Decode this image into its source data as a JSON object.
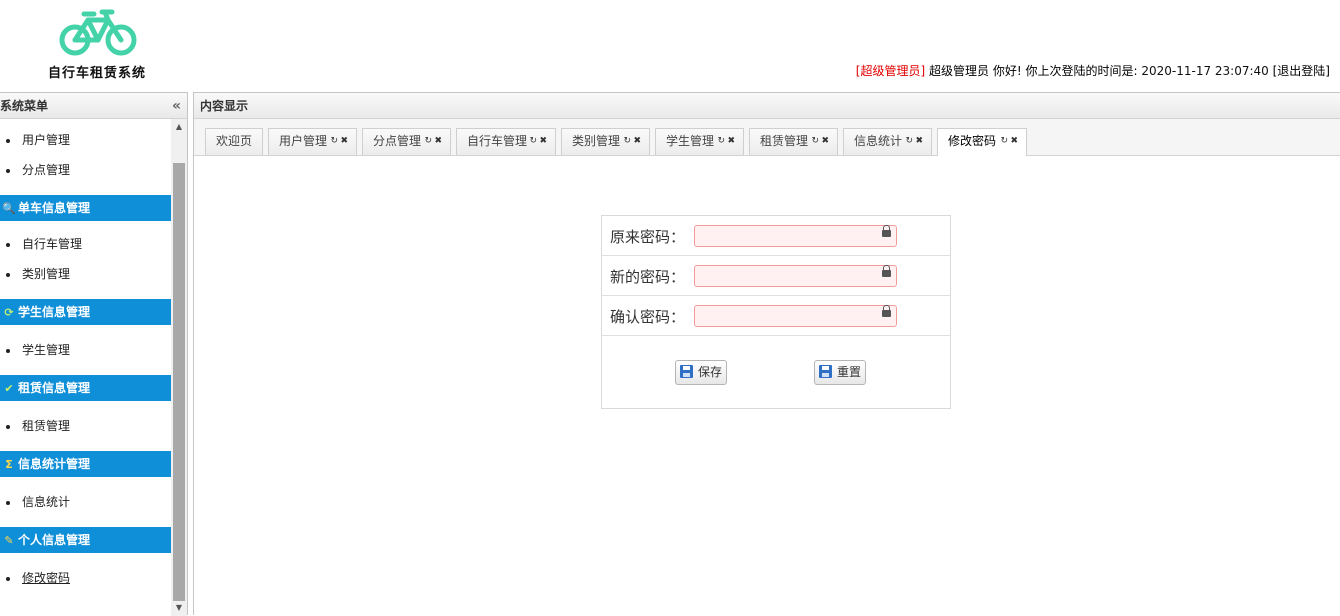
{
  "header": {
    "logo_text": "自行车租赁系统",
    "brand_color": "#44d3a8",
    "user_role": "[超级管理员]",
    "user_name": "超级管理员",
    "greeting": "你好! 你上次登陆的时间是:",
    "last_login": "2020-11-17 23:07:40",
    "logout_label": "[退出登陆]"
  },
  "sidebar": {
    "title": "系统菜单",
    "collapse_icon": "«",
    "group0": {
      "items": [
        "用户管理",
        "分点管理"
      ]
    },
    "groups": [
      {
        "title": "单车信息管理",
        "icon": "search-icon",
        "items": [
          "自行车管理",
          "类别管理"
        ]
      },
      {
        "title": "学生信息管理",
        "icon": "refresh-icon",
        "items": [
          "学生管理"
        ]
      },
      {
        "title": "租赁信息管理",
        "icon": "check-icon",
        "items": [
          "租赁管理"
        ]
      },
      {
        "title": "信息统计管理",
        "icon": "sum-icon",
        "items": [
          "信息统计"
        ]
      },
      {
        "title": "个人信息管理",
        "icon": "pencil-icon",
        "items": [
          "修改密码"
        ]
      }
    ],
    "accent_color": "#0f8fd8"
  },
  "center": {
    "title": "内容显示",
    "tabs": [
      {
        "label": "欢迎页",
        "closable": false
      },
      {
        "label": "用户管理",
        "closable": true
      },
      {
        "label": "分点管理",
        "closable": true
      },
      {
        "label": "自行车管理",
        "closable": true
      },
      {
        "label": "类别管理",
        "closable": true
      },
      {
        "label": "学生管理",
        "closable": true
      },
      {
        "label": "租赁管理",
        "closable": true
      },
      {
        "label": "信息统计",
        "closable": true
      },
      {
        "label": "修改密码",
        "closable": true,
        "selected": true
      }
    ]
  },
  "form": {
    "old_password_label": "原来密码：",
    "new_password_label": "新的密码：",
    "confirm_password_label": "确认密码：",
    "old_password_value": "",
    "new_password_value": "",
    "confirm_password_value": "",
    "save_label": "保存",
    "reset_label": "重置"
  }
}
